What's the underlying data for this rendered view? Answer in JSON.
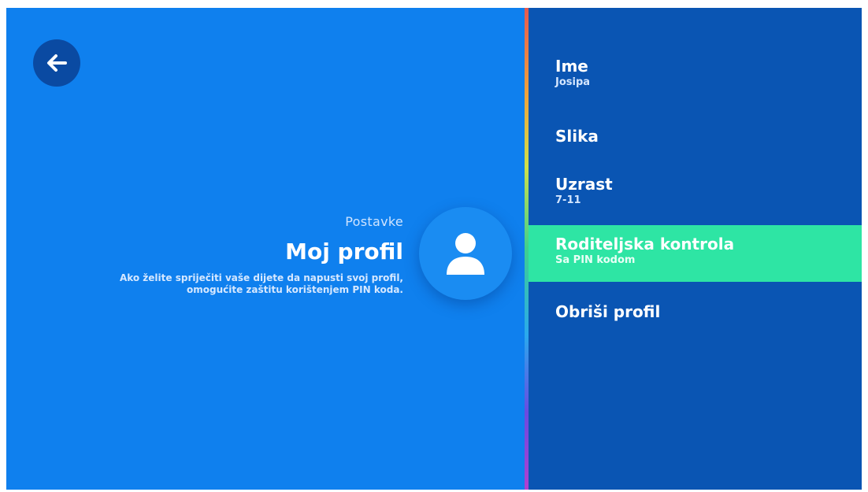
{
  "header": {
    "back_icon": "arrow-left-icon"
  },
  "profile": {
    "breadcrumb": "Postavke",
    "title": "Moj profil",
    "description_line1": "Ako želite spriječiti vaše dijete da napusti svoj profil,",
    "description_line2": "omogućite zaštitu korištenjem PIN koda.",
    "avatar_icon": "user-icon"
  },
  "menu": {
    "items": [
      {
        "label": "Ime",
        "value": "Josipa"
      },
      {
        "label": "Slika",
        "value": ""
      },
      {
        "label": "Uzrast",
        "value": "7-11"
      },
      {
        "label": "Roditeljska kontrola",
        "value": "Sa PIN kodom",
        "active": true
      },
      {
        "label": "Obriši profil",
        "value": ""
      }
    ]
  },
  "colors": {
    "left_bg": "#0f80ee",
    "right_bg": "#0a55b3",
    "active_item": "#2ee5a4",
    "text": "#ffffff"
  }
}
